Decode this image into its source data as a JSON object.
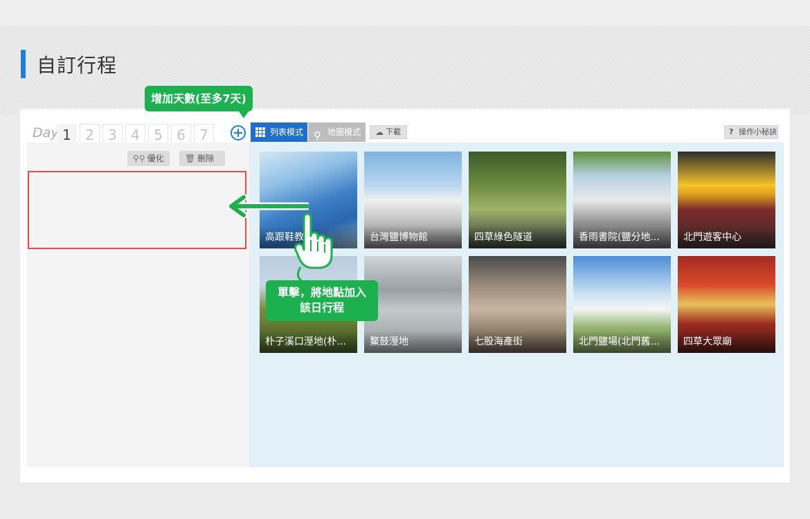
{
  "page_title": "自訂行程",
  "colors": {
    "accent": "#1f7de0",
    "tip_green": "#1cb14e",
    "drop_zone_border": "#e84c4c",
    "content_bg": "#e2f0f7"
  },
  "day_selector": {
    "label": "Day",
    "days": [
      "1",
      "2",
      "3",
      "4",
      "5",
      "6",
      "7"
    ],
    "active_day": "1",
    "add_icon": "plus-circle-icon"
  },
  "tips": {
    "add_days": "增加天數(至多7天)",
    "click_line1": "單擊，將地點加入",
    "click_line2": "該日行程"
  },
  "day_tools": {
    "optimize_label": "優化",
    "optimize_icon": "map-pins-icon",
    "delete_label": "刪除",
    "delete_icon": "trash-icon"
  },
  "toolbar": {
    "list_mode_label": "列表模式",
    "list_mode_icon": "grid-icon",
    "map_mode_label": "地圖模式",
    "map_mode_icon": "map-pin-icon",
    "download_label": "下載",
    "download_icon": "cloud-download-icon",
    "help_label": "操作小秘訣",
    "help_icon": "question-icon"
  },
  "places": [
    {
      "name": "高跟鞋教堂"
    },
    {
      "name": "台灣鹽博物館"
    },
    {
      "name": "四草綠色隧道"
    },
    {
      "name": "香雨書院(鹽分地..."
    },
    {
      "name": "北門遊客中心"
    },
    {
      "name": "朴子溪口溼地(朴..."
    },
    {
      "name": "鰲鼓溼地"
    },
    {
      "name": "七股海產街"
    },
    {
      "name": "北門鹽場(北門舊..."
    },
    {
      "name": "四草大眾廟"
    }
  ]
}
